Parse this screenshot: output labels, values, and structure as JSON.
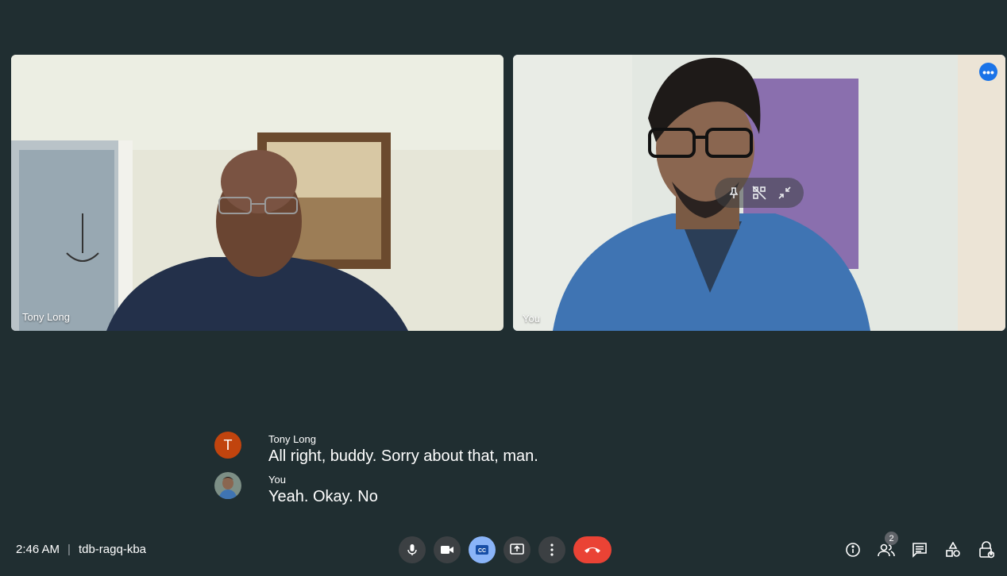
{
  "tiles": [
    {
      "name": "Tony Long"
    },
    {
      "name": "You"
    }
  ],
  "captions": [
    {
      "avatar_letter": "T",
      "avatar_color": "#c1440e",
      "speaker": "Tony Long",
      "text": "All right, buddy. Sorry about that, man."
    },
    {
      "speaker": "You",
      "text": "Yeah. Okay. No"
    }
  ],
  "meeting": {
    "time": "2:46 AM",
    "separator": "|",
    "code": "tdb-ragq-kba"
  },
  "controls": {
    "center": [
      "microphone-icon",
      "camera-icon",
      "closed-captions-icon",
      "present-screen-icon",
      "more-options-icon",
      "end-call-icon"
    ],
    "right": [
      "info-icon",
      "people-icon",
      "chat-icon",
      "activities-icon",
      "host-controls-icon"
    ]
  },
  "people_count": "2",
  "colors": {
    "background": "#202e31",
    "accent": "#1a73e8",
    "captions_active": "#8ab4f8",
    "end_call": "#ea4335"
  }
}
